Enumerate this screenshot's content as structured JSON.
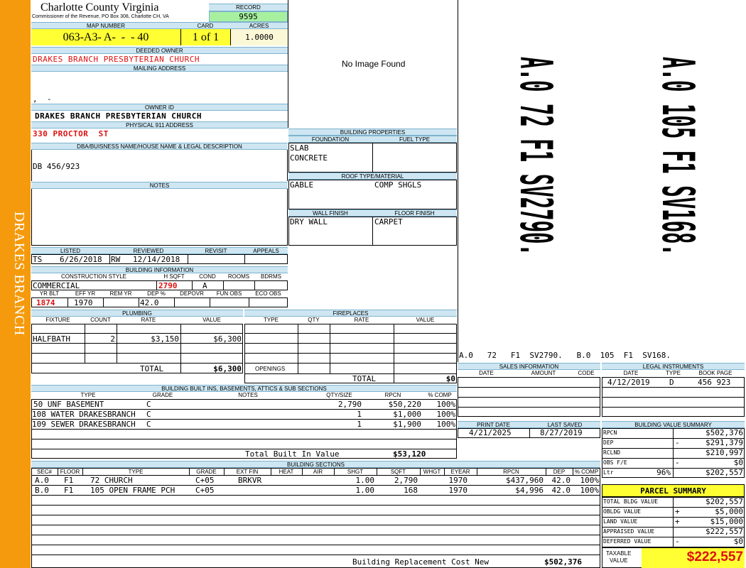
{
  "sidebar": {
    "label": "DRAKES BRANCH"
  },
  "header": {
    "county": "Charlotte County Virginia",
    "commissioner": "Commissioner of the Revenue, PO Box 308, Charlotte CH, VA",
    "record_label": "RECORD",
    "record": "9595",
    "map_number_label": "MAP NUMBER",
    "map_number": "063-A3- A-  -  - 40",
    "card_label": "CARD",
    "card": "1 of 1",
    "acres_label": "ACRES",
    "acres": "1.0000"
  },
  "owner": {
    "deeded_owner_label": "DEEDED OWNER",
    "deeded_owner": "DRAKES BRANCH PRESBYTERIAN CHURCH",
    "mailing_address_label": "MAILING ADDRESS",
    "mailing_address": ",  -",
    "owner_id_label": "OWNER ID",
    "owner_id": "DRAKES BRANCH PRESBYTERIAN CHURCH",
    "physical_label": "PHYSICAL 911 ADDRESS",
    "physical_address": "330 PROCTOR  ST",
    "dba_label": "DBA/BUISNESS NAME/HOUSE NAME & LEGAL DESCRIPTION",
    "dba": "DB 456/923",
    "notes_label": "NOTES"
  },
  "image": {
    "no_image": "No Image Found"
  },
  "listing": {
    "listed_label": "LISTED",
    "reviewed_label": "REVIEWED",
    "revisit_label": "REVISIT",
    "appeals_label": "APPEALS",
    "listed_by": "TS",
    "listed_date": "6/26/2018",
    "reviewed_by": "RW",
    "reviewed_date": "12/14/2018"
  },
  "building_info": {
    "title": "BUILDING INFORMATION",
    "h_construction": "CONSTRUCTION STYLE",
    "h_sqft": "H SQFT",
    "h_cond": "COND",
    "h_rooms": "ROOMS",
    "h_bdrms": "BDRMS",
    "construction": "COMMERCIAL",
    "sqft": "2790",
    "cond": "A",
    "h_yrblt": "YR BLT",
    "h_effyr": "EFF YR",
    "h_remyr": "REM YR",
    "h_dep": "DEP %",
    "h_depovr": "DEPOVR",
    "h_funobs": "FUN OBS",
    "h_ecoobs": "ECO OBS",
    "yrblt": "1874",
    "effyr": "1970",
    "dep": "42.0"
  },
  "building_props": {
    "title": "BUILDING PROPERTIES",
    "foundation_label": "FOUNDATION",
    "fuel_label": "FUEL TYPE",
    "foundation": [
      "SLAB",
      "CONCRETE"
    ],
    "roof_label": "ROOF TYPE/MATERIAL",
    "roof_type": "GABLE",
    "roof_material": "COMP SHGLS",
    "wall_label": "WALL FINISH",
    "floor_label": "FLOOR FINISH",
    "wall": "DRY WALL",
    "floor": "CARPET"
  },
  "sketch": {
    "caption": "A.0   72   F1  SV2790.   B.0  105  F1  SV168.",
    "labels": [
      "A.0 72 F1 SV2790.",
      "A.0 105 F1 SV168."
    ]
  },
  "plumbing": {
    "title": "PLUMBING",
    "h_fixture": "FIXTURE",
    "h_count": "COUNT",
    "h_rate": "RATE",
    "h_value": "VALUE",
    "rows": [
      {
        "fixture": "HALFBATH",
        "count": "2",
        "rate": "$3,150",
        "value": "$6,300"
      }
    ],
    "total_label": "TOTAL",
    "total": "$6,300"
  },
  "fireplaces": {
    "title": "FIREPLACES",
    "h_type": "TYPE",
    "h_qty": "QTY",
    "h_rate": "RATE",
    "h_value": "VALUE",
    "openings_label": "OPENINGS",
    "total_label": "TOTAL",
    "total": "$0"
  },
  "builtins": {
    "title": "BUILDING BUILT INS, BASEMENTS, ATTICS & SUB SECTIONS",
    "h_type": "TYPE",
    "h_grade": "GRADE",
    "h_notes": "NOTES",
    "h_qty": "QTY/SIZE",
    "h_rpcn": "RPCN",
    "h_comp": "% COMP",
    "rows": [
      {
        "type": "50 UNF BASEMENT",
        "grade": "C",
        "qty": "2,790",
        "rpcn": "$50,220",
        "comp": "100%"
      },
      {
        "type": "108 WATER DRAKESBRANCH",
        "grade": "C",
        "qty": "1",
        "rpcn": "$1,000",
        "comp": "100%"
      },
      {
        "type": "109 SEWER DRAKESBRANCH",
        "grade": "C",
        "qty": "1",
        "rpcn": "$1,900",
        "comp": "100%"
      }
    ],
    "total_label": "Total Built In Value",
    "total": "$53,120"
  },
  "sales": {
    "title": "SALES INFORMATION",
    "h_date": "DATE",
    "h_amount": "AMOUNT",
    "h_code": "CODE"
  },
  "legal": {
    "title": "LEGAL INSTRUMENTS",
    "h_date": "DATE",
    "h_type": "TYPE",
    "h_book": "BOOK PAGE",
    "date": "4/12/2019",
    "type": "D",
    "book": "456 923"
  },
  "print": {
    "print_label": "PRINT DATE",
    "saved_label": "LAST SAVED",
    "print_date": "4/21/2025",
    "last_saved": "8/27/2019"
  },
  "value_summary": {
    "title": "BUILDING VALUE SUMMARY",
    "rows": [
      {
        "label": "RPCN",
        "sign": "",
        "pct": "",
        "value": "$502,376"
      },
      {
        "label": "DEP",
        "sign": "-",
        "pct": "",
        "value": "$291,379"
      },
      {
        "label": "RCLND",
        "sign": "",
        "pct": "",
        "value": "$210,997"
      },
      {
        "label": "OBS F/E",
        "sign": "-",
        "pct": "",
        "value": "$0"
      },
      {
        "label": "Ltr",
        "sign": "",
        "pct": "96%",
        "value": "$202,557"
      }
    ]
  },
  "parcel_summary": {
    "title": "PARCEL SUMMARY",
    "rows": [
      {
        "label": "TOTAL BLDG VALUE",
        "sign": "",
        "value": "$202,557"
      },
      {
        "label": "OBLDG VALUE",
        "sign": "+",
        "value": "$5,000"
      },
      {
        "label": "LAND VALUE",
        "sign": "+",
        "value": "$15,000"
      },
      {
        "label": "APPRAISED VALUE",
        "sign": "",
        "value": "$222,557"
      },
      {
        "label": "DEFERRED VALUE",
        "sign": "-",
        "value": "$0"
      }
    ],
    "taxable_label_1": "TAXABLE",
    "taxable_label_2": "VALUE",
    "taxable": "$222,557"
  },
  "sections": {
    "title": "BUILDING SECTIONS",
    "headers": [
      "SEC#",
      "FLOOR",
      "TYPE",
      "GRADE",
      "EXT FIN",
      "HEAT",
      "AIR",
      "SHGT",
      "SQFT",
      "WHGT",
      "EYEAR",
      "RPCN",
      "DEP",
      "% COMP"
    ],
    "rows": [
      {
        "sec": "A.0",
        "floor": "F1",
        "type": "72 CHURCH",
        "grade": "C+05",
        "extfin": "BRKVR",
        "shgt": "1.00",
        "sqft": "2,790",
        "eyear": "1970",
        "rpcn": "$437,960",
        "dep": "42.0",
        "comp": "100%"
      },
      {
        "sec": "B.0",
        "floor": "F1",
        "type": "105 OPEN FRAME PCH",
        "grade": "C+05",
        "extfin": "",
        "shgt": "1.00",
        "sqft": "168",
        "eyear": "1970",
        "rpcn": "$4,996",
        "dep": "42.0",
        "comp": "100%"
      }
    ],
    "replacement_label": "Building Replacement Cost New",
    "replacement": "$502,376"
  }
}
